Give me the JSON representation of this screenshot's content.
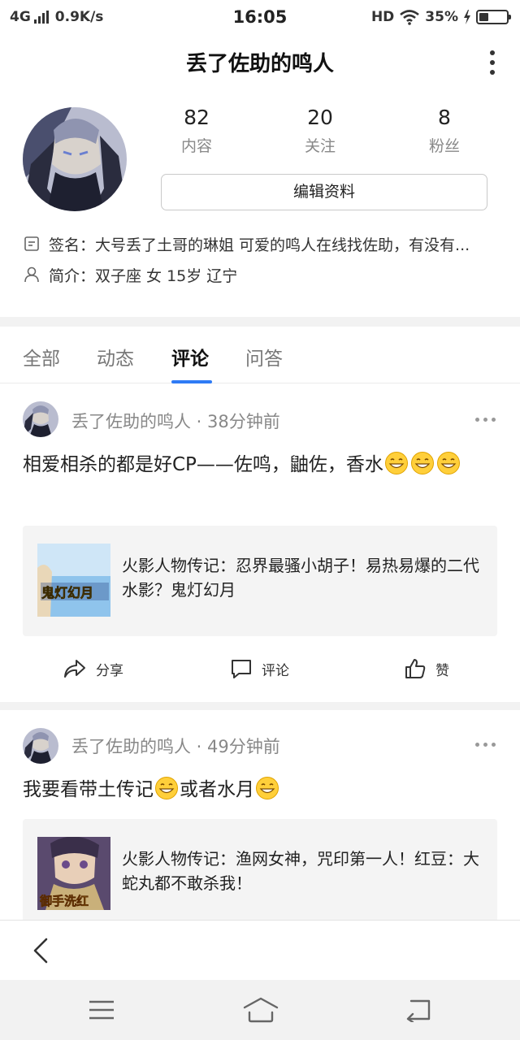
{
  "status_bar": {
    "network": "4G",
    "speed": "0.9K/s",
    "time": "16:05",
    "hd": "HD",
    "battery": "35%",
    "battery_level": 0.35
  },
  "header": {
    "title": "丢了佐助的鸣人"
  },
  "profile": {
    "stats": [
      {
        "value": "82",
        "label": "内容"
      },
      {
        "value": "20",
        "label": "关注"
      },
      {
        "value": "8",
        "label": "粉丝"
      }
    ],
    "edit_label": "编辑资料",
    "signature_prefix": "签名：",
    "signature": "大号丢了土哥的琳姐 可爱的鸣人在线找佐助，有没有...",
    "bio_prefix": "简介：",
    "bio": "双子座  女  15岁  辽宁"
  },
  "tabs": [
    {
      "label": "全部"
    },
    {
      "label": "动态"
    },
    {
      "label": "评论"
    },
    {
      "label": "问答"
    }
  ],
  "posts": [
    {
      "author": "丢了佐助的鸣人",
      "time": "38分钟前",
      "meta": "丢了佐助的鸣人 · 38分钟前",
      "text_part1": "相爱相杀的都是好CP——佐鸣，鼬佐，香水",
      "card_title": "火影人物传记：忍界最骚小胡子！易热易爆的二代水影？鬼灯幻月",
      "thumb_text": "鬼灯幻月"
    },
    {
      "author": "丢了佐助的鸣人",
      "time": "49分钟前",
      "meta": "丢了佐助的鸣人 · 49分钟前",
      "text_part1": "我要看带土传记",
      "text_part2": "或者水月",
      "card_title": "火影人物传记：渔网女神，咒印第一人！红豆：大蛇丸都不敢杀我！",
      "thumb_text": "御手洗红"
    }
  ],
  "actions": {
    "share": "分享",
    "comment": "评论",
    "like": "赞"
  },
  "colors": {
    "accent": "#2f7bf5",
    "band": "#f2f2f2",
    "card": "#f4f4f4"
  }
}
